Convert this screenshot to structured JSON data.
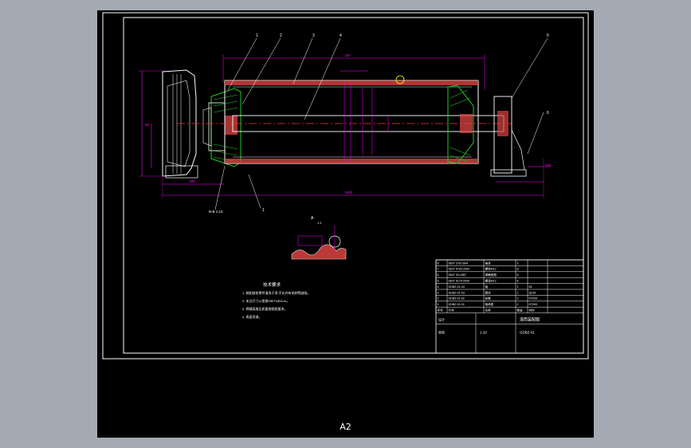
{
  "colors": {
    "background": "#a4a9b3",
    "sheet": "#000000",
    "frame": "#ffffff",
    "dimension": "#ff00ff",
    "part": "#ffffff",
    "hatch": "#22cc22",
    "fill": "#dd4444",
    "leader": "#ffffff",
    "text": "#ffffff",
    "centerline": "#ff3333",
    "accent": "#ffff00"
  },
  "sheet": {
    "size_label": "A2"
  },
  "callouts": {
    "c1": "1",
    "c2": "2",
    "c3": "3",
    "c4": "4",
    "c5": "5",
    "c6": "6",
    "c7": "1"
  },
  "dimensions": {
    "top": "100",
    "overall": "1800",
    "left_ext": "180",
    "height_small": "80",
    "right_small": "200",
    "section": "B-B 1:10"
  },
  "detail": {
    "label": "A",
    "scale": "1:1"
  },
  "notes": {
    "title": "技术要求",
    "lines": [
      "1. 装配前各零件清洗干净,不允许有毛刺等缺陷。",
      "2. 未注尺寸公差按GB/T1804-m。",
      "3. 焊缝高度及质量按图纸要求。",
      "4. 表面涂漆。"
    ]
  },
  "title_block": {
    "parts_rows": [
      [
        "8",
        "GB/T 276-1994",
        "轴承",
        "2",
        ""
      ],
      [
        "7",
        "GB/T 5783-2000",
        "螺栓M12",
        "8",
        ""
      ],
      [
        "6",
        "GB/T 93-1987",
        "弹簧垫圈",
        "8",
        ""
      ],
      [
        "5",
        "GB/T 6170-2000",
        "螺母M12",
        "8",
        ""
      ],
      [
        "4",
        "GDBZ-01-04",
        "轴",
        "1",
        "45"
      ],
      [
        "3",
        "GDBZ-01-03",
        "筒体",
        "1",
        "Q235"
      ],
      [
        "2",
        "GDBZ-01-02",
        "轮毂",
        "2",
        "HT200"
      ],
      [
        "1",
        "GDBZ-01-01",
        "轴承座",
        "2",
        "HT200"
      ]
    ],
    "header": [
      "序号",
      "代号",
      "名称",
      "数量",
      "材料"
    ],
    "drawing_name": "滚筒装配图",
    "drawing_no": "GDBZ-01",
    "scale": "1:10",
    "designer": "设计",
    "check": "审核"
  }
}
